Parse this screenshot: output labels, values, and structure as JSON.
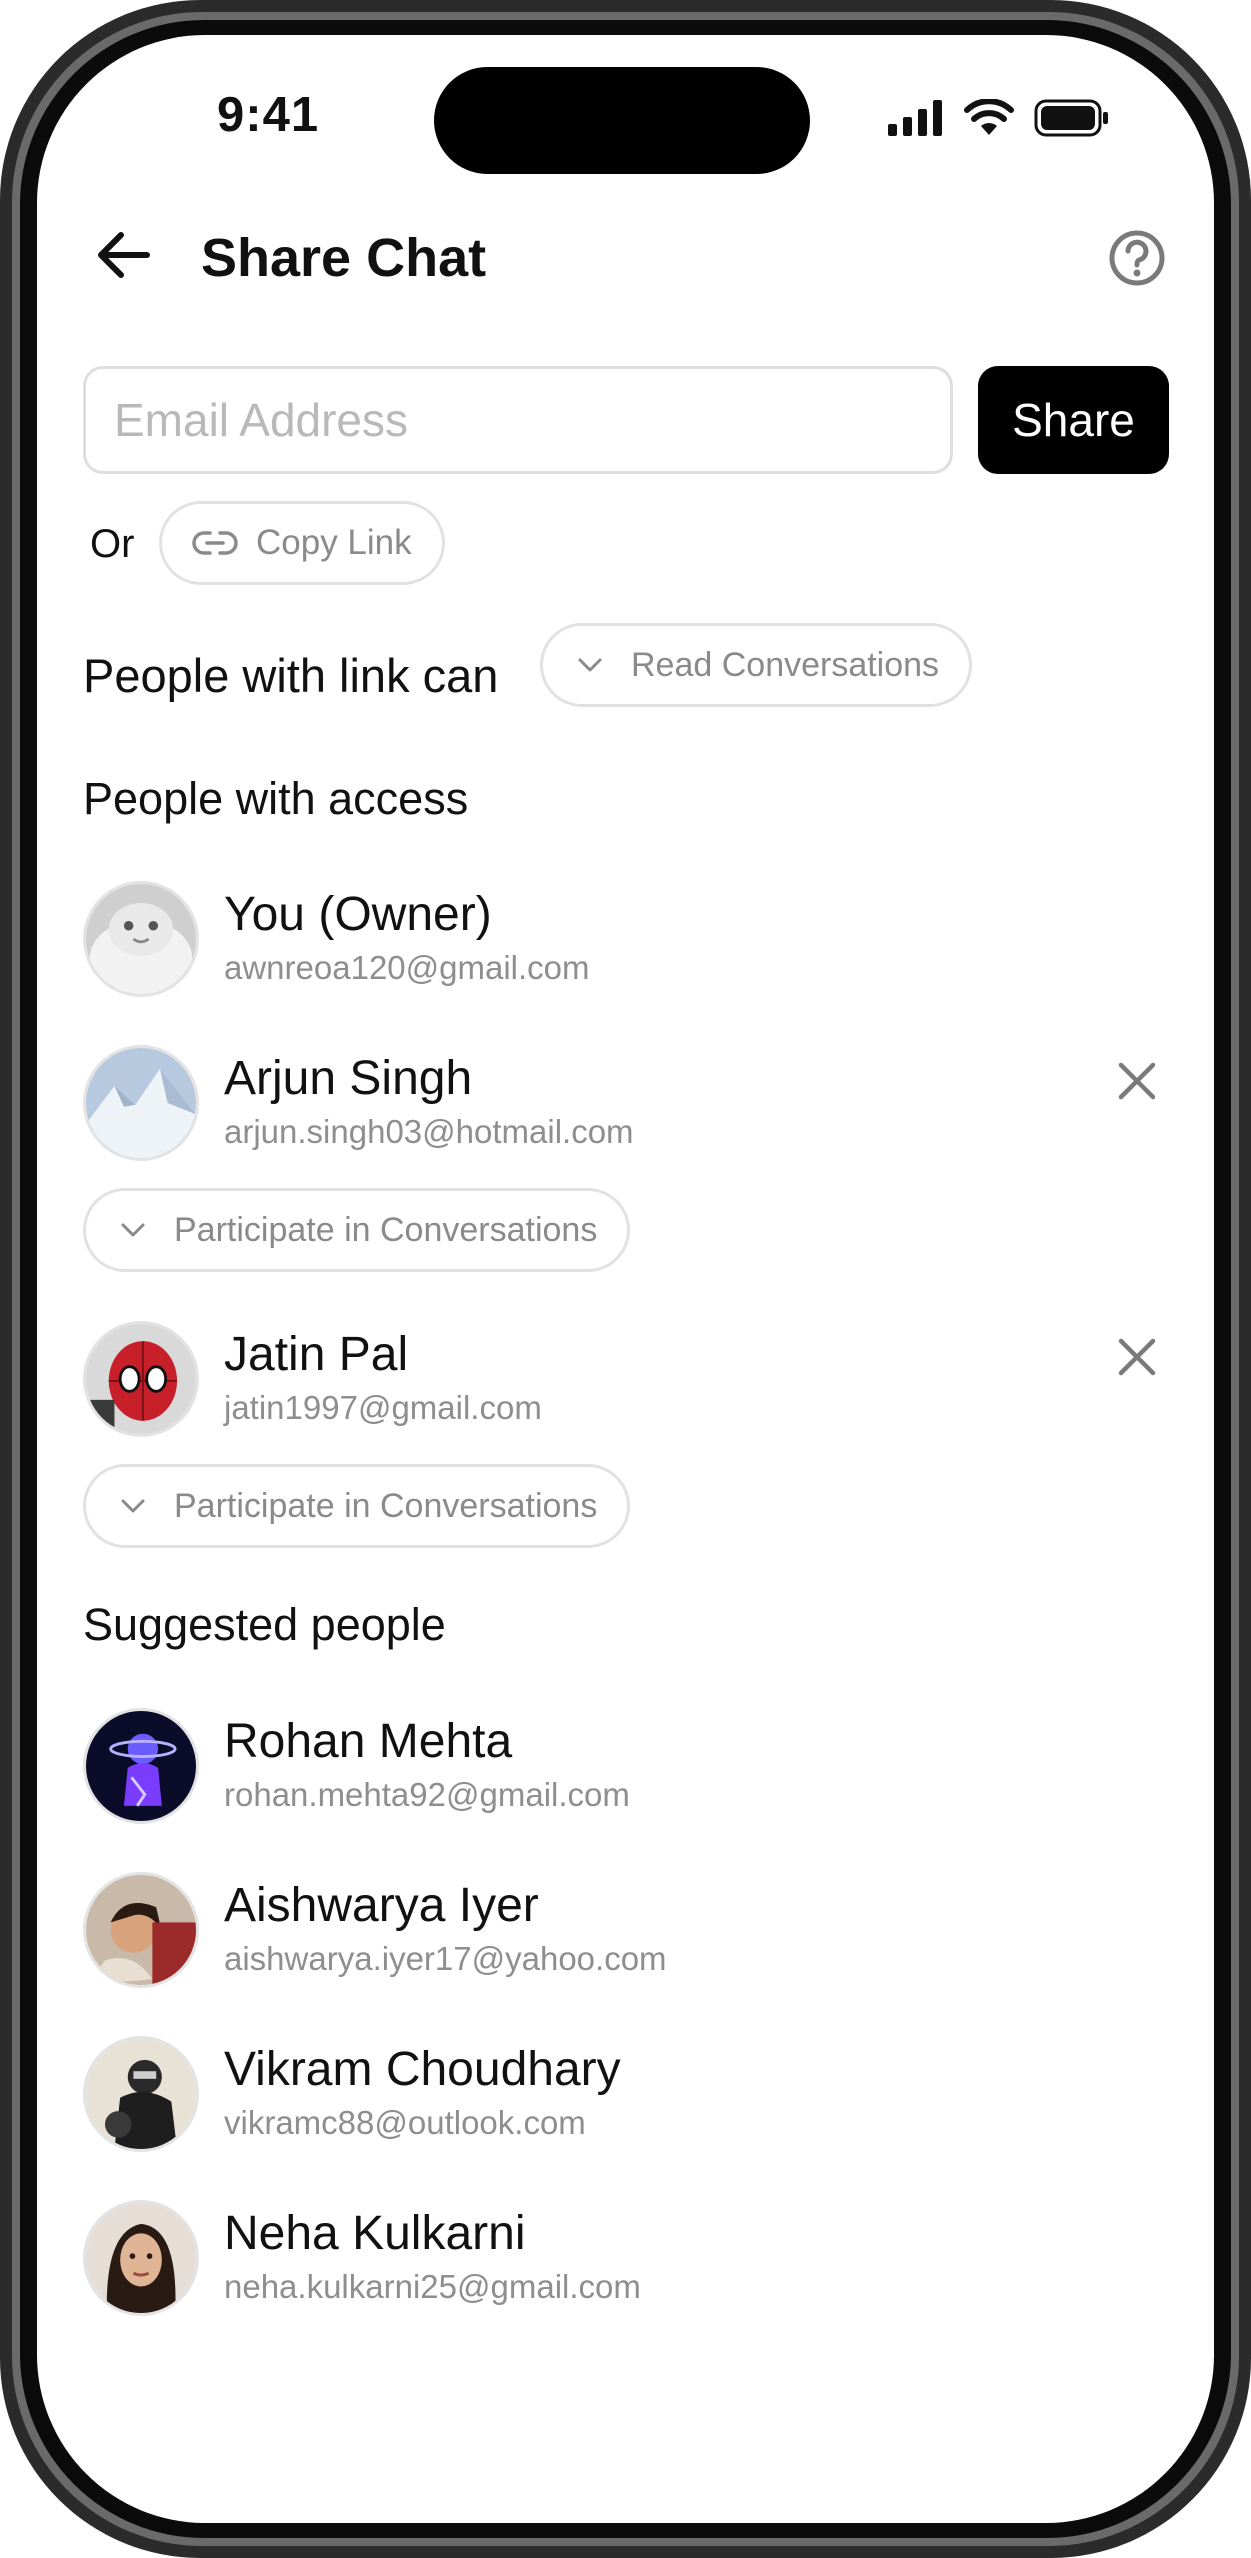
{
  "status_bar": {
    "time": "9:41"
  },
  "header": {
    "title": "Share Chat"
  },
  "share_form": {
    "email_placeholder": "Email Address",
    "email_value": "",
    "share_label": "Share",
    "or_label": "Or",
    "copy_link_label": "Copy Link"
  },
  "link_permission": {
    "label": "People with link can",
    "value": "Read Conversations"
  },
  "access": {
    "title": "People with access",
    "people": [
      {
        "name": "You (Owner)",
        "email": "awnreoa120@gmail.com"
      },
      {
        "name": "Arjun Singh",
        "email": "arjun.singh03@hotmail.com",
        "permission": "Participate in Conversations"
      },
      {
        "name": "Jatin Pal",
        "email": "jatin1997@gmail.com",
        "permission": "Participate in Conversations"
      }
    ]
  },
  "suggested": {
    "title": "Suggested people",
    "people": [
      {
        "name": "Rohan Mehta",
        "email": "rohan.mehta92@gmail.com"
      },
      {
        "name": "Aishwarya Iyer",
        "email": "aishwarya.iyer17@yahoo.com"
      },
      {
        "name": "Vikram Choudhary",
        "email": "vikramc88@outlook.com"
      },
      {
        "name": "Neha Kulkarni",
        "email": "neha.kulkarni25@gmail.com"
      }
    ]
  }
}
